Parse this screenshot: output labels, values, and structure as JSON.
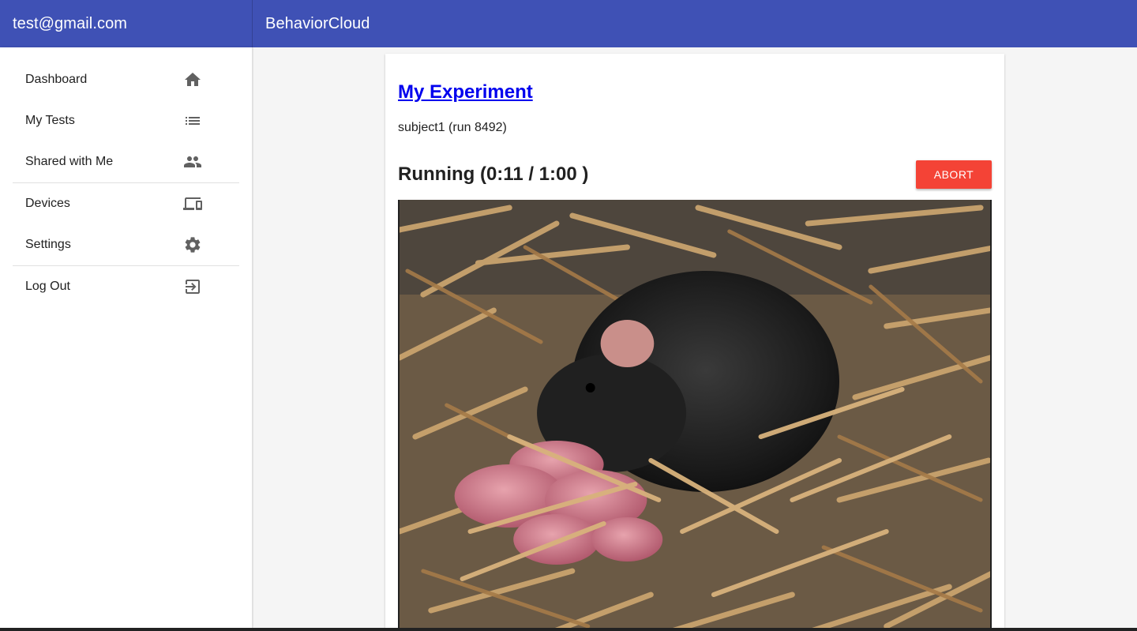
{
  "header": {
    "account_email": "test@gmail.com",
    "app_name": "BehaviorCloud",
    "color": "#3f51b5"
  },
  "sidebar": {
    "items": [
      {
        "label": "Dashboard",
        "icon": "home-icon"
      },
      {
        "label": "My Tests",
        "icon": "list-icon"
      },
      {
        "label": "Shared with Me",
        "icon": "people-icon"
      },
      {
        "label": "Devices",
        "icon": "devices-icon"
      },
      {
        "label": "Settings",
        "icon": "gear-icon"
      },
      {
        "label": "Log Out",
        "icon": "logout-icon"
      }
    ]
  },
  "main": {
    "experiment_title": "My Experiment",
    "subject_line": "subject1 (run 8492)",
    "status_text": "Running (0:11 / 1:00 )",
    "abort_label": "ABORT",
    "abort_color": "#f44336",
    "video_feed": "mouse-nest-live-feed"
  }
}
